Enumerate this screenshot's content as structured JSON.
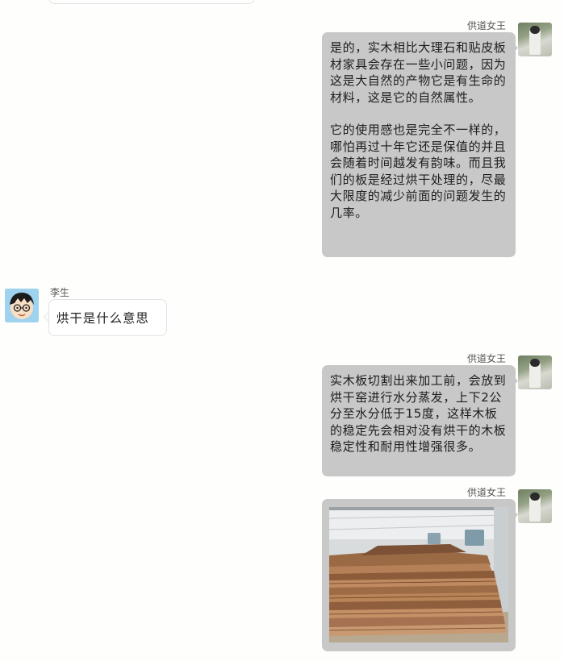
{
  "colors": {
    "background": "#fefefc",
    "bubble_incoming": "#ffffff",
    "bubble_outgoing": "#c8c8c8"
  },
  "messages": [
    {
      "sender": "供道女王",
      "side": "right",
      "paragraphs": [
        "是的，实木相比大理石和贴皮板材家具会存在一些小问题，因为这是大自然的产物它是有生命的材料，这是它的自然属性。",
        "它的使用感也是完全不一样的，哪怕再过十年它还是保值的并且会随着时间越发有韵味。而且我们的板是经过烘干处理的，尽最大限度的减少前面的问题发生的几率。"
      ]
    },
    {
      "sender": "李生",
      "side": "left",
      "text": "烘干是什么意思"
    },
    {
      "sender": "供道女王",
      "side": "right",
      "text": "实木板切割出来加工前，会放到烘干窑进行水分蒸发，上下2公分至水分低于15度，这样木板的稳定先会相对没有烘干的木板稳定性和耐用性增强很多。"
    },
    {
      "sender": "供道女王",
      "side": "right",
      "image": "photo of stacked timber slabs inside a drying kiln"
    }
  ]
}
